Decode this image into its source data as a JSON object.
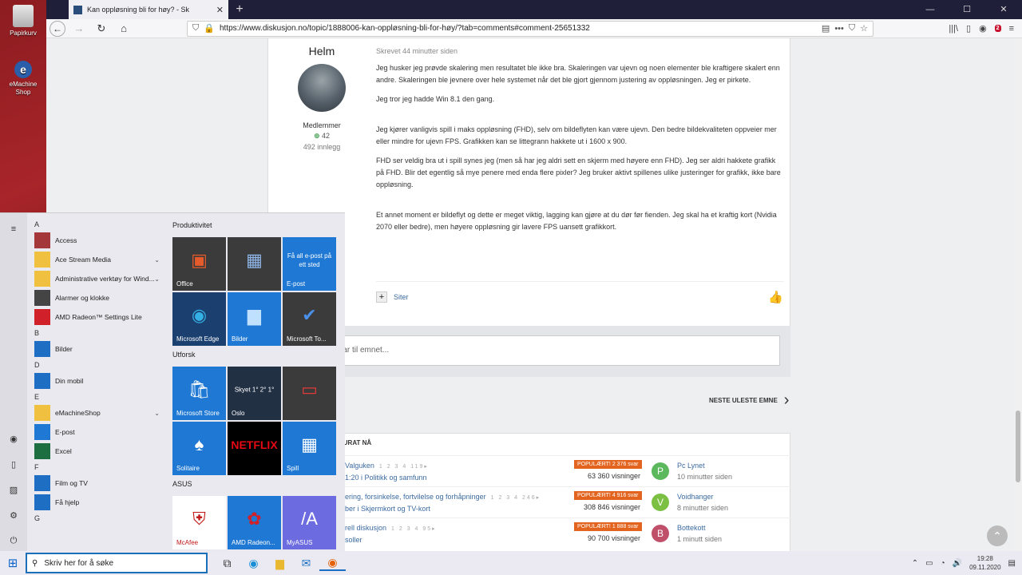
{
  "desktop": {
    "icons": [
      {
        "label": "Papirkurv"
      },
      {
        "label": "eMachine Shop"
      }
    ]
  },
  "browser": {
    "tab_title": "Kan oppløsning bli for høy? - Sk",
    "url": "https://www.diskusjon.no/topic/1888006-kan-oppløsning-bli-for-høy/?tab=comments#comment-25651332",
    "abp_count": "2"
  },
  "post": {
    "author": "Helm",
    "group": "Medlemmer",
    "reputation": "42",
    "posts": "492 innlegg",
    "meta": "Skrevet 44 minutter siden",
    "paragraphs": [
      "Jeg husker jeg prøvde skalering men resultatet ble ikke bra. Skaleringen var ujevn og noen elementer ble kraftigere skalert enn andre. Skaleringen ble jevnere over hele systemet når det ble gjort gjennom justering av oppløsningen. Jeg er pirkete.",
      "Jeg tror jeg hadde Win 8.1 den gang.",
      "Jeg kjører vanligvis spill i maks oppløsning (FHD), selv om bildeflyten kan være ujevn. Den bedre bildekvaliteten oppveier mer eller mindre for ujevn FPS. Grafikken kan se littegrann hakkete ut i 1600 x 900.",
      "FHD ser veldig bra ut i spill synes jeg (men så har jeg aldri sett en skjerm med høyere enn FHD). Jeg ser aldri hakkete grafikk på FHD. Blir det egentlig så mye penere med enda flere pixler? Jeg bruker aktivt spillenes ulike justeringer for grafikk, ikke bare oppløsning.",
      "Et annet moment er bildeflyt og dette er meget viktig, lagging kan gjøre at du dør før fienden. Jeg skal ha et kraftig kort (Nvidia 2070 eller bedre), men høyere oppløsning gir lavere FPS uansett grafikkort."
    ],
    "quote_label": "Siter",
    "plus_label": "+"
  },
  "reply": {
    "placeholder": "riv svar til emnet..."
  },
  "next_topic": "NESTE ULESTE EMNE",
  "hot": {
    "header": "KURAT NÅ",
    "rows": [
      {
        "title": "Valguken",
        "pages": "1 2 3 4 119▸",
        "sub": "1:20 i Politikk og samfunn",
        "badge": "POPULÆRT!   2 376 svar",
        "views": "63 360 visninger",
        "avatar": "P",
        "avatar_color": "#5cb85c",
        "user": "Pc Lynet",
        "time": "10 minutter siden"
      },
      {
        "title": "ering, forsinkelse, fortvilelse og forhåpninger",
        "pages": "1 2 3 4 246▸",
        "sub": "ber i Skjermkort og TV-kort",
        "badge": "POPULÆRT!   4 916 svar",
        "views": "308 846 visninger",
        "avatar": "V",
        "avatar_color": "#7bc043",
        "user": "Voidhanger",
        "time": "8 minutter siden"
      },
      {
        "title": "rell diskusjon",
        "pages": "1 2 3 4 95▸",
        "sub": "soller",
        "badge": "POPULÆRT!   1 888 svar",
        "views": "90 700 visninger",
        "avatar": "B",
        "avatar_color": "#c0506a",
        "user": "Bottekott",
        "time": "1 minutt siden"
      }
    ]
  },
  "start_menu": {
    "apps": [
      {
        "type": "letter",
        "label": "A"
      },
      {
        "type": "app",
        "label": "Access",
        "color": "#a4373a"
      },
      {
        "type": "app",
        "label": "Ace Stream Media",
        "color": "#f0c040",
        "folder": true
      },
      {
        "type": "app",
        "label": "Administrative verktøy for Wind...",
        "color": "#f0c040",
        "folder": true
      },
      {
        "type": "app",
        "label": "Alarmer og klokke",
        "color": "#444444"
      },
      {
        "type": "app",
        "label": "AMD Radeon™ Settings Lite",
        "color": "#d0202a"
      },
      {
        "type": "letter",
        "label": "B"
      },
      {
        "type": "app",
        "label": "Bilder",
        "color": "#1e6fc4"
      },
      {
        "type": "letter",
        "label": "D"
      },
      {
        "type": "app",
        "label": "Din mobil",
        "color": "#1e6fc4"
      },
      {
        "type": "letter",
        "label": "E"
      },
      {
        "type": "app",
        "label": "eMachineShop",
        "color": "#f0c040",
        "folder": true
      },
      {
        "type": "app",
        "label": "E-post",
        "color": "#1e78d4"
      },
      {
        "type": "app",
        "label": "Excel",
        "color": "#1d6f42"
      },
      {
        "type": "letter",
        "label": "F"
      },
      {
        "type": "app",
        "label": "Film og TV",
        "color": "#1e6fc4"
      },
      {
        "type": "app",
        "label": "Få hjelp",
        "color": "#1e6fc4"
      },
      {
        "type": "letter",
        "label": "G"
      }
    ],
    "groups": [
      {
        "title": "Produktivitet",
        "tiles": [
          {
            "label": "Office",
            "bg": "#3b3b3b",
            "glyph": "▣",
            "glyph_color": "#e55b2b"
          },
          {
            "label": "",
            "bg": "#3b3b3b",
            "glyph": "▦",
            "glyph_color": "#8fb6e8"
          },
          {
            "label": "E-post",
            "bg": "#1e78d4",
            "glyph": "Få all e-post på ett sted",
            "glyph_color": "#ffffff",
            "small": true
          },
          {
            "label": "Microsoft Edge",
            "bg": "#1b3f6e",
            "glyph": "◉",
            "glyph_color": "#35b0e5"
          },
          {
            "label": "Bilder",
            "bg": "#1e78d4",
            "glyph": "▆",
            "glyph_color": "#bfe0ff"
          },
          {
            "label": "Microsoft To...",
            "bg": "#3b3b3b",
            "glyph": "✔",
            "glyph_color": "#4a8fe8"
          }
        ]
      },
      {
        "title": "Utforsk",
        "tiles": [
          {
            "label": "Microsoft Store",
            "bg": "#1e78d4",
            "glyph": "🛍",
            "glyph_color": "#ffffff"
          },
          {
            "label": "Oslo",
            "bg": "#223044",
            "glyph": "Skyet 1° 2° 1°",
            "glyph_color": "#ffffff",
            "small": true
          },
          {
            "label": "",
            "bg": "#3b3b3b",
            "glyph": "▭",
            "glyph_color": "#e03a3a"
          },
          {
            "label": "Solitaire",
            "bg": "#1e78d4",
            "glyph": "♠",
            "glyph_color": "#ffffff"
          },
          {
            "label": "",
            "bg": "#000000",
            "glyph": "NETFLIX",
            "glyph_color": "#e50914",
            "netflix": true
          },
          {
            "label": "Spill",
            "bg": "#1e78d4",
            "glyph": "▦",
            "glyph_color": "#ffffff"
          }
        ]
      },
      {
        "title": "ASUS",
        "tiles": [
          {
            "label": "McAfee",
            "bg": "#ffffff",
            "glyph": "⛨",
            "glyph_color": "#c01818",
            "dark_label": true
          },
          {
            "label": "AMD Radeon...",
            "bg": "#1e78d4",
            "glyph": "✿",
            "glyph_color": "#d0202a"
          },
          {
            "label": "MyASUS",
            "bg": "#6c6ce0",
            "glyph": "/A",
            "glyph_color": "#ffffff"
          }
        ]
      }
    ]
  },
  "taskbar": {
    "search_placeholder": "Skriv her for å søke",
    "time": "19:28",
    "date": "09.11.2020"
  }
}
